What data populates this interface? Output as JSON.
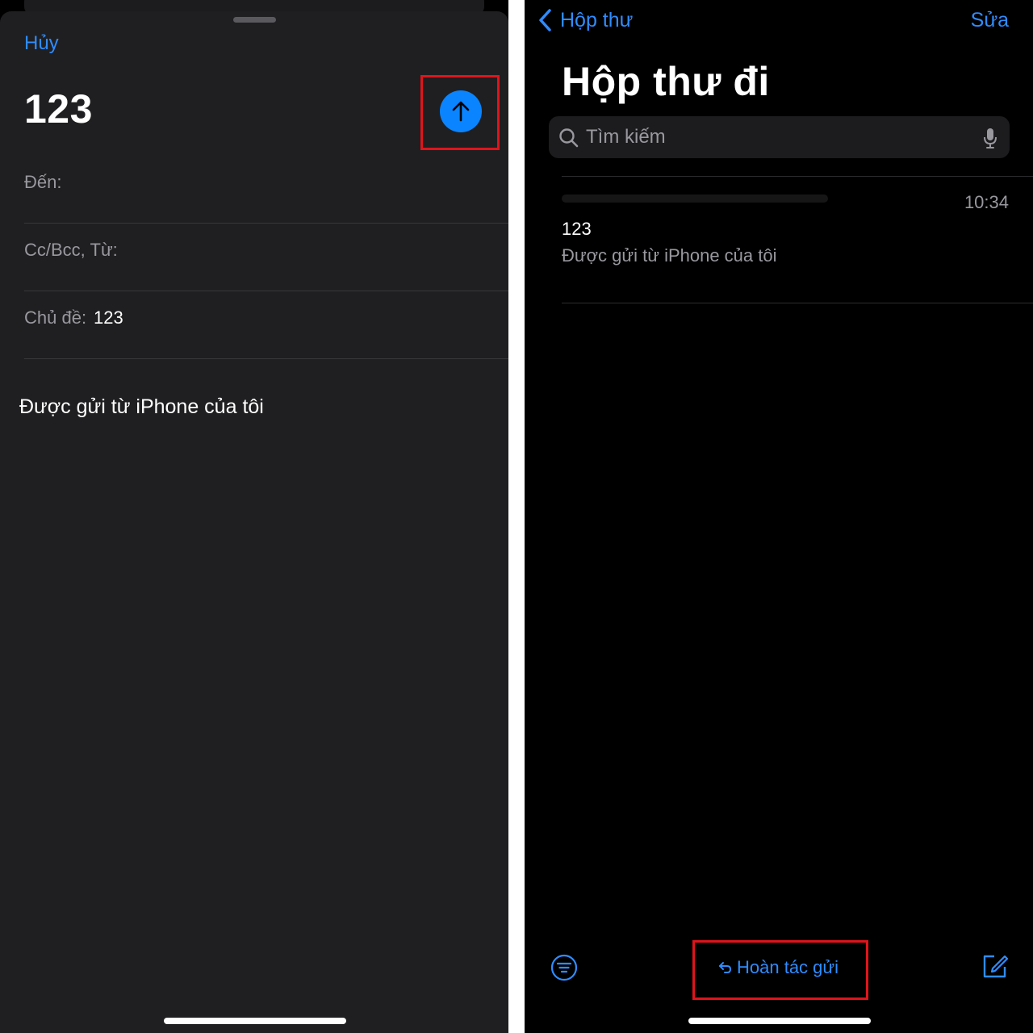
{
  "compose": {
    "cancel": "Hủy",
    "title": "123",
    "to_label": "Đến:",
    "ccbcc_label": "Cc/Bcc, Từ:",
    "subject_label": "Chủ đề:",
    "subject_value": "123",
    "body": "Được gửi từ iPhone của tôi",
    "send_icon": "arrow-up-icon"
  },
  "outbox": {
    "back_label": "Hộp thư",
    "edit_label": "Sửa",
    "title": "Hộp thư đi",
    "search_placeholder": "Tìm kiếm",
    "message": {
      "time": "10:34",
      "subject": "123",
      "preview": "Được gửi từ iPhone của tôi"
    },
    "toolbar": {
      "undo_label": "Hoàn tác gửi",
      "filter_icon": "filter-icon",
      "compose_icon": "compose-icon"
    }
  },
  "colors": {
    "accent": "#0a84ff",
    "link": "#2f8cff",
    "highlight": "#e0141b",
    "sheet_bg": "#1f1f21",
    "screen_bg": "#000000"
  }
}
